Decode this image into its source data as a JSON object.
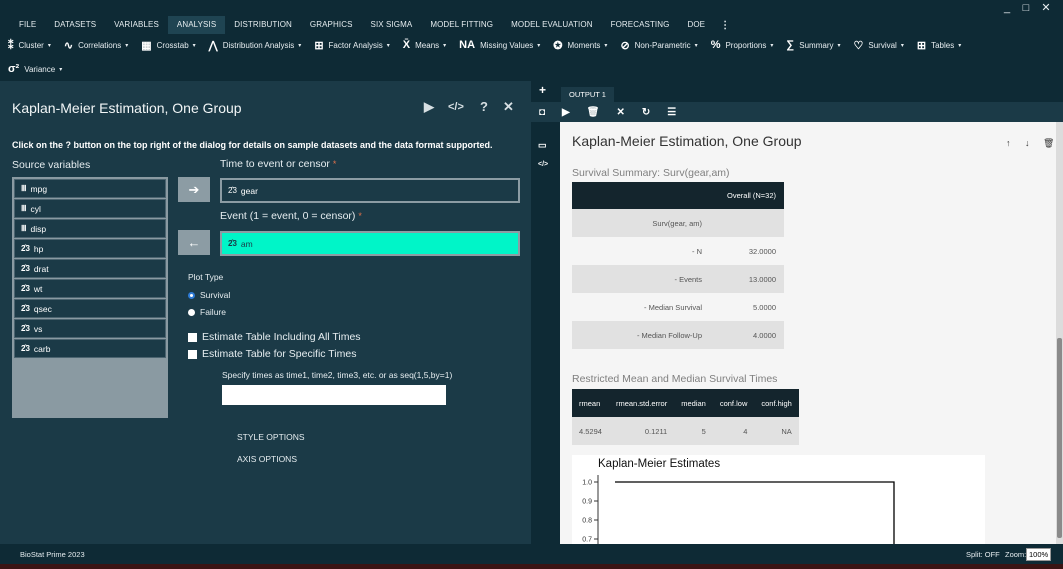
{
  "window": {
    "minimize": "_",
    "maximize": "□",
    "close": "✕"
  },
  "menu": {
    "items": [
      "FILE",
      "DATASETS",
      "VARIABLES",
      "ANALYSIS",
      "DISTRIBUTION",
      "GRAPHICS",
      "SIX SIGMA",
      "MODEL FITTING",
      "MODEL EVALUATION",
      "FORECASTING",
      "DOE"
    ],
    "active": "ANALYSIS",
    "more": "⋮"
  },
  "toolbar": {
    "row1": [
      {
        "label": "Cluster",
        "icon": "cluster-icon",
        "glyph": "⁑"
      },
      {
        "label": "Correlations",
        "icon": "correlation-icon",
        "glyph": "∿"
      },
      {
        "label": "Crosstab",
        "icon": "crosstab-icon",
        "glyph": "▦"
      },
      {
        "label": "Distribution Analysis",
        "icon": "distribution-icon",
        "glyph": "⋀"
      },
      {
        "label": "Factor Analysis",
        "icon": "factor-icon",
        "glyph": "⊞"
      },
      {
        "label": "Means",
        "icon": "means-icon",
        "glyph": "X̄"
      },
      {
        "label": "Missing Values",
        "icon": "missing-values-icon",
        "glyph": "NA"
      },
      {
        "label": "Moments",
        "icon": "moments-icon",
        "glyph": "✪"
      },
      {
        "label": "Non-Parametric",
        "icon": "nonparametric-icon",
        "glyph": "⊘"
      },
      {
        "label": "Proportions",
        "icon": "proportions-icon",
        "glyph": "%"
      },
      {
        "label": "Summary",
        "icon": "summary-icon",
        "glyph": "∑"
      },
      {
        "label": "Survival",
        "icon": "survival-icon",
        "glyph": "♡"
      },
      {
        "label": "Tables",
        "icon": "tables-icon",
        "glyph": "⊞"
      }
    ],
    "row2": [
      {
        "label": "Variance",
        "icon": "variance-icon",
        "glyph": "σ²"
      }
    ],
    "caret": "▾"
  },
  "dialog": {
    "title": "Kaplan-Meier Estimation, One Group",
    "help_text": "Click on the ? button on the top right of the dialog for details on sample datasets and the data format supported.",
    "source_label": "Source variables",
    "variables": [
      {
        "name": "mpg",
        "type": "scale"
      },
      {
        "name": "cyl",
        "type": "scale"
      },
      {
        "name": "disp",
        "type": "scale"
      },
      {
        "name": "hp",
        "type": "ordinal"
      },
      {
        "name": "drat",
        "type": "ordinal"
      },
      {
        "name": "wt",
        "type": "ordinal"
      },
      {
        "name": "qsec",
        "type": "ordinal"
      },
      {
        "name": "vs",
        "type": "ordinal"
      },
      {
        "name": "carb",
        "type": "ordinal"
      }
    ],
    "type_glyphs": {
      "scale": "Ⅲ",
      "ordinal": "2̂3"
    },
    "time_label": "Time to event or censor",
    "time_value": "gear",
    "event_label": "Event (1 = event, 0 = censor)",
    "event_value": "am",
    "required_mark": "*",
    "arrow_right": "➔",
    "arrow_left": "←",
    "plot_type_label": "Plot Type",
    "radio_survival": "Survival",
    "radio_failure": "Failure",
    "check_all_times": "Estimate Table Including All Times",
    "check_specific_times": "Estimate Table for Specific Times",
    "times_label": "Specify times as time1, time2, time3, etc. or as seq(1,5,by=1)",
    "times_value": "",
    "style_options": "STYLE OPTIONS",
    "axis_options": "AXIS OPTIONS",
    "header_icons": {
      "run": "▶",
      "code": "</>",
      "help": "?",
      "close": "✕"
    }
  },
  "output": {
    "add_tab": "+",
    "tab_label": "OUTPUT 1",
    "toolbar_glyphs": [
      "◘",
      "▶",
      "🗑",
      "✕",
      "↻",
      "☰"
    ],
    "title": "Kaplan-Meier Estimation, One Group",
    "controls": {
      "up": "↑",
      "down": "↓",
      "delete": "🗑"
    },
    "side_icons": {
      "collapse": "▭",
      "code": "</>"
    },
    "summary_title": "Survival Summary: Surv(gear,am)",
    "summary_header": "Overall (N=32)",
    "summary_rows": [
      {
        "label": "Surv(gear, am)",
        "value": ""
      },
      {
        "label": "- N",
        "value": "32.0000"
      },
      {
        "label": "- Events",
        "value": "13.0000"
      },
      {
        "label": "- Median Survival",
        "value": "5.0000"
      },
      {
        "label": "- Median Follow-Up",
        "value": "4.0000"
      }
    ],
    "rmean_title": "Restricted Mean and Median Survival Times",
    "rmean_headers": [
      "rmean",
      "rmean.std.error",
      "median",
      "conf.low",
      "conf.high"
    ],
    "rmean_row": [
      "4.5294",
      "0.1211",
      "5",
      "4",
      "NA"
    ],
    "plot_title": "Kaplan-Meier Estimates",
    "plot_yticks": [
      "1.0",
      "0.9",
      "0.8",
      "0.7"
    ]
  },
  "status": {
    "app_name": "BioStat Prime 2023",
    "split": "Split: OFF",
    "zoom_label": "Zoom:",
    "zoom_value": "100%"
  },
  "colors": {
    "background": "#1b3a47",
    "bar": "#0e2a35",
    "selected_field": "#00f5c8",
    "required": "#e0714a",
    "table_header": "#14252d"
  }
}
